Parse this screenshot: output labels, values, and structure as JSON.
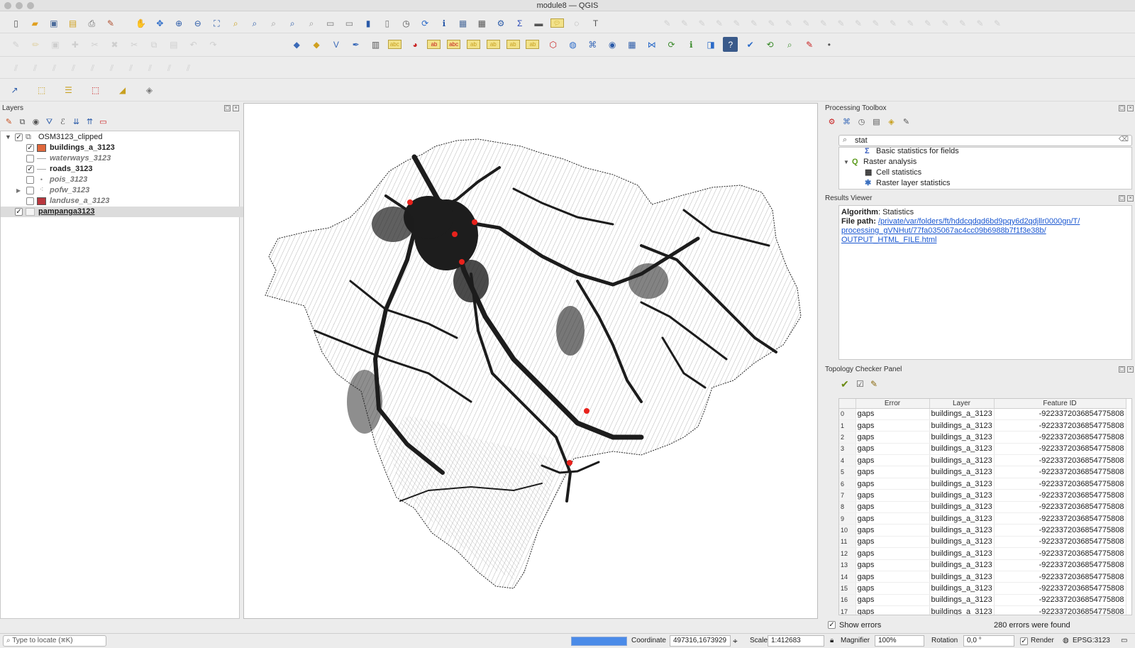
{
  "window": {
    "title": "module8 — QGIS"
  },
  "layers_panel": {
    "title": "Layers",
    "items": [
      {
        "name": "OSM3123_clipped",
        "checked": "✓",
        "style": "group"
      },
      {
        "name": "buildings_a_3123",
        "checked": "✓",
        "style": "bold",
        "color": "#e0683c"
      },
      {
        "name": "waterways_3123",
        "checked": "",
        "style": "italic"
      },
      {
        "name": "roads_3123",
        "checked": "✓",
        "style": "bold"
      },
      {
        "name": "pois_3123",
        "checked": "",
        "style": "italic"
      },
      {
        "name": "pofw_3123",
        "checked": "",
        "style": "italic"
      },
      {
        "name": "landuse_a_3123",
        "checked": "",
        "style": "italic",
        "color": "#b8373e"
      },
      {
        "name": "pampanga3123",
        "checked": "✓",
        "style": "selected"
      }
    ]
  },
  "processing_toolbox": {
    "title": "Processing Toolbox",
    "search_value": "stat",
    "items": [
      {
        "label": "Basic statistics for fields",
        "icon": "sigma-icon"
      },
      {
        "label": "Raster analysis",
        "icon": "qgis-logo-icon"
      },
      {
        "label": "Cell statistics",
        "icon": "cell-statistics-icon"
      },
      {
        "label": "Raster layer statistics",
        "icon": "gear-icon"
      }
    ]
  },
  "results_viewer": {
    "title": "Results Viewer",
    "algorithm_label": "Algorithm",
    "algorithm_value": ": Statistics",
    "file_label": "File path",
    "file_colon": ":",
    "file_line1": "/private/var/folders/ft/hddcqdqd6bd9pqy6d2qdjllr0000gn/T/",
    "file_line2": "processing_gVNHut/77fa035067ac4cc09b6988b7f1f3e38b/",
    "file_line3": "OUTPUT_HTML_FILE.html"
  },
  "topology": {
    "title": "Topology Checker Panel",
    "columns": [
      "Error",
      "Layer",
      "Feature ID"
    ],
    "rows": [
      {
        "n": "0",
        "error": "gaps",
        "layer": "buildings_a_3123",
        "fid": "-9223372036854775808"
      },
      {
        "n": "1",
        "error": "gaps",
        "layer": "buildings_a_3123",
        "fid": "-9223372036854775808"
      },
      {
        "n": "2",
        "error": "gaps",
        "layer": "buildings_a_3123",
        "fid": "-9223372036854775808"
      },
      {
        "n": "3",
        "error": "gaps",
        "layer": "buildings_a_3123",
        "fid": "-9223372036854775808"
      },
      {
        "n": "4",
        "error": "gaps",
        "layer": "buildings_a_3123",
        "fid": "-9223372036854775808"
      },
      {
        "n": "5",
        "error": "gaps",
        "layer": "buildings_a_3123",
        "fid": "-9223372036854775808"
      },
      {
        "n": "6",
        "error": "gaps",
        "layer": "buildings_a_3123",
        "fid": "-9223372036854775808"
      },
      {
        "n": "7",
        "error": "gaps",
        "layer": "buildings_a_3123",
        "fid": "-9223372036854775808"
      },
      {
        "n": "8",
        "error": "gaps",
        "layer": "buildings_a_3123",
        "fid": "-9223372036854775808"
      },
      {
        "n": "9",
        "error": "gaps",
        "layer": "buildings_a_3123",
        "fid": "-9223372036854775808"
      },
      {
        "n": "10",
        "error": "gaps",
        "layer": "buildings_a_3123",
        "fid": "-9223372036854775808"
      },
      {
        "n": "11",
        "error": "gaps",
        "layer": "buildings_a_3123",
        "fid": "-9223372036854775808"
      },
      {
        "n": "12",
        "error": "gaps",
        "layer": "buildings_a_3123",
        "fid": "-9223372036854775808"
      },
      {
        "n": "13",
        "error": "gaps",
        "layer": "buildings_a_3123",
        "fid": "-9223372036854775808"
      },
      {
        "n": "14",
        "error": "gaps",
        "layer": "buildings_a_3123",
        "fid": "-9223372036854775808"
      },
      {
        "n": "15",
        "error": "gaps",
        "layer": "buildings_a_3123",
        "fid": "-9223372036854775808"
      },
      {
        "n": "16",
        "error": "gaps",
        "layer": "buildings_a_3123",
        "fid": "-9223372036854775808"
      },
      {
        "n": "17",
        "error": "gaps",
        "layer": "buildings_a_3123",
        "fid": "-9223372036854775808"
      }
    ],
    "show_errors_label": "Show errors",
    "errors_found": "280 errors were found"
  },
  "status_bar": {
    "locate_placeholder": "Type to locate (⌘K)",
    "progress": 1.0,
    "coordinate_label": "Coordinate",
    "coordinate_value": "497316,1673929",
    "scale_label": "Scale",
    "scale_value": "1:412683",
    "magnifier_label": "Magnifier",
    "magnifier_value": "100%",
    "rotation_label": "Rotation",
    "rotation_value": "0,0 °",
    "render_label": "Render",
    "crs_label": "EPSG:3123"
  },
  "toolbar_icons": {
    "row1": [
      "new-project-icon",
      "open-project-icon",
      "save-project-icon",
      "save-as-icon",
      "print-layout-icon",
      "style-manager-icon",
      "pan-icon",
      "pan-to-selection-icon",
      "zoom-in-icon",
      "zoom-out-icon",
      "zoom-full-icon",
      "zoom-selection-icon",
      "zoom-layer-icon",
      "zoom-native-icon",
      "zoom-last-icon",
      "zoom-next-icon",
      "new-map-view-icon",
      "new-3d-view-icon",
      "bookmark-icon",
      "show-bookmarks-icon",
      "temporal-icon",
      "refresh-icon",
      "identify-icon",
      "attribute-table-icon",
      "field-calculator-icon",
      "processing-icon",
      "statistics-icon",
      "measure-icon",
      "map-tips-icon",
      "annotation-icon",
      "text-annotation-icon"
    ],
    "row2": [
      "digitize-icon",
      "edit-pencil-icon",
      "save-edits-icon",
      "add-feature-icon",
      "vertex-tool-icon",
      "delete-icon",
      "cut-icon",
      "copy-icon",
      "paste-icon",
      "undo-icon",
      "redo-icon",
      "new-geopackage-icon",
      "new-shapefile-icon",
      "new-spatialite-icon",
      "new-virtual-icon",
      "new-memory-icon",
      "label-icon",
      "diagram-icon",
      "highlight-pin-icon",
      "label-pin-icon",
      "show-pin-icon",
      "move-label-icon",
      "rotate-label-icon",
      "change-label-icon",
      "georef-icon",
      "globe-icon",
      "python-icon",
      "camera-icon",
      "grid-icon",
      "network-icon",
      "refresh-layers-icon",
      "help-ext-icon",
      "qgis-plugin-icon",
      "help-icon",
      "topology-icon",
      "layer-refresh-icon",
      "locate-icon",
      "edit-map-icon",
      "point-icon"
    ],
    "row4": [
      "profile-icon",
      "select-icon",
      "layer-style-icon",
      "deselect-icon",
      "label-tool-icon",
      "mask-icon"
    ]
  }
}
